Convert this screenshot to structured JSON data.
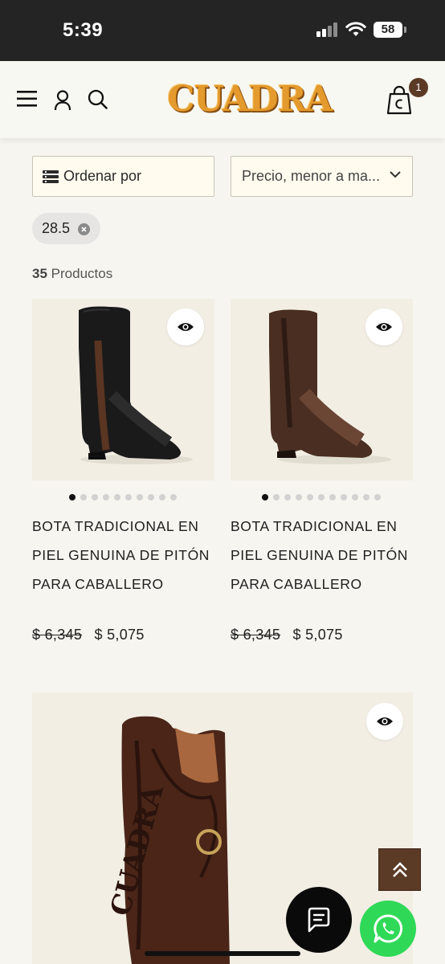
{
  "status_bar": {
    "time": "5:39",
    "battery": "58"
  },
  "header": {
    "logo_text": "CUADRA",
    "cart_count": "1",
    "icons": [
      "menu-icon",
      "user-icon",
      "search-icon",
      "shopping-bag-icon"
    ]
  },
  "toolbar": {
    "sort_label": "Ordenar por",
    "sort_selected": "Precio, menor a ma..."
  },
  "filters": {
    "active_chip": "28.5"
  },
  "results": {
    "count": "35",
    "count_label": "Productos"
  },
  "products": [
    {
      "name": "BOTA TRADICIONAL EN PIEL GENUINA DE PITÓN PARA CABALLERO",
      "old_price": "$ 6,345",
      "price": "$ 5,075"
    },
    {
      "name": "BOTA TRADICIONAL EN PIEL GENUINA DE PITÓN PARA CABALLERO",
      "old_price": "$ 6,345",
      "price": "$ 5,075"
    }
  ],
  "colors": {
    "brand_brown": "#5b3a26",
    "logo_gold": "#e49a2c",
    "whatsapp": "#2fd957",
    "background": "#f6f5ef"
  }
}
